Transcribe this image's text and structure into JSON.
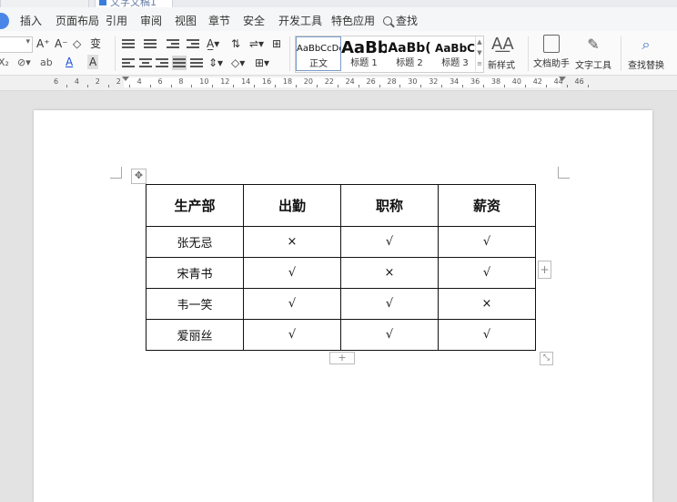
{
  "title_strip": {
    "doc_tab_fragment": "文字文稿1"
  },
  "menu": {
    "items": [
      "插入",
      "页面布局",
      "引用",
      "审阅",
      "视图",
      "章节",
      "安全",
      "开发工具",
      "特色应用"
    ],
    "search_label": "查找"
  },
  "toolbar": {
    "font_glyphs": {
      "grow": "A⁺",
      "shrink": "A⁻",
      "clear": "◇",
      "phonetic": "变",
      "sub": "X₂",
      "highlight": "ab",
      "font_color": "A",
      "char_border": "A"
    },
    "styles": [
      {
        "sample": "AaBbCcDd",
        "name": "正文"
      },
      {
        "sample": "AaBb",
        "name": "标题 1"
      },
      {
        "sample": "AaBb(",
        "name": "标题 2"
      },
      {
        "sample": "AaBbC",
        "name": "标题 3"
      }
    ],
    "new_style": "新样式",
    "doc_assistant": "文档助手",
    "text_tools": "文字工具",
    "find_replace": "查找替换"
  },
  "ruler": {
    "ticks": [
      "6",
      "4",
      "2",
      "2",
      "4",
      "6",
      "8",
      "10",
      "12",
      "14",
      "16",
      "18",
      "20",
      "22",
      "24",
      "26",
      "28",
      "30",
      "32",
      "34",
      "36",
      "38",
      "40",
      "42",
      "44",
      "46"
    ]
  },
  "table": {
    "headers": [
      "生产部",
      "出勤",
      "职称",
      "薪资"
    ],
    "rows": [
      [
        "张无忌",
        "×",
        "√",
        "√"
      ],
      [
        "宋青书",
        "√",
        "×",
        "√"
      ],
      [
        "韦一笑",
        "√",
        "√",
        "×"
      ],
      [
        "爱丽丝",
        "√",
        "√",
        "√"
      ]
    ]
  },
  "colors": {
    "accent": "#4a86e8",
    "table_border": "#111111",
    "page": "#ffffff",
    "workspace": "#e3e3e3"
  }
}
